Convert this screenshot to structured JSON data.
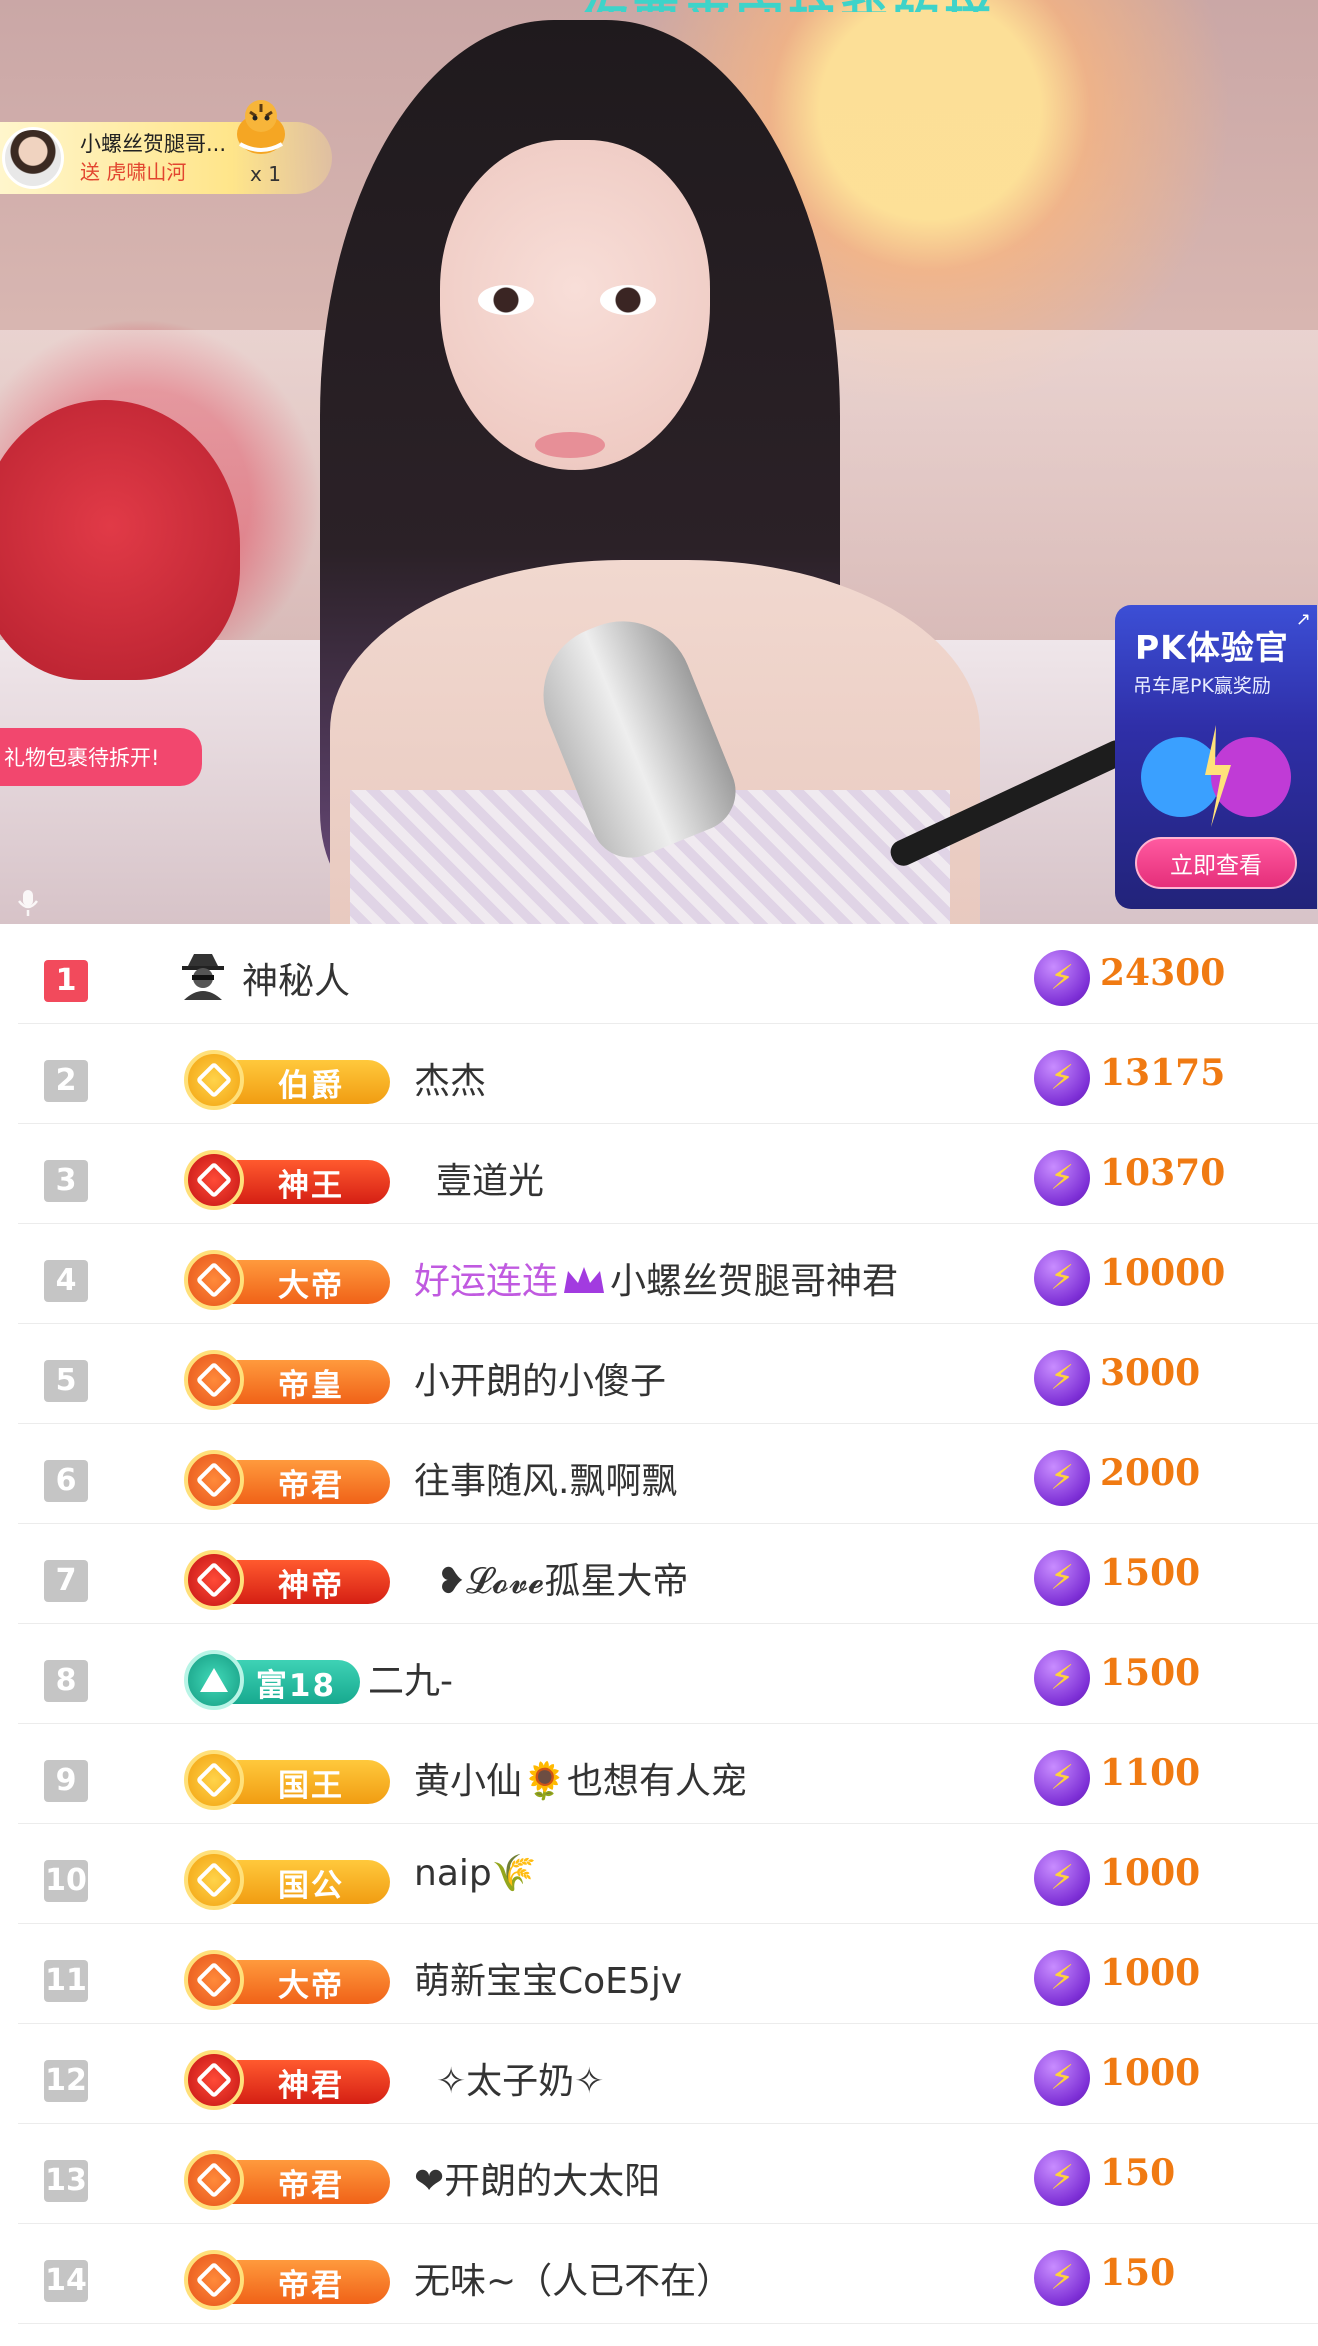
{
  "stream": {
    "top_caption": "你要来守护我的样",
    "gift_toast": {
      "sender": "小螺丝贺腿哥...",
      "action": "送 虎啸山河",
      "count": "x 1"
    },
    "pack_badge": "礼物包裹待拆开!",
    "pk_panel": {
      "title": "PK体验官",
      "subtitle": "吊车尾PK赢奖励",
      "button": "立即查看",
      "close": "↗"
    }
  },
  "leaderboard": [
    {
      "rank": "1",
      "badge": "",
      "badge_style": "none",
      "name": "神秘人",
      "name_prefix": "",
      "score": "24300"
    },
    {
      "rank": "2",
      "badge": "伯爵",
      "badge_style": "gold",
      "name": "杰杰",
      "name_prefix": "",
      "score": "13175"
    },
    {
      "rank": "3",
      "badge": "神王",
      "badge_style": "red",
      "name": "壹道光",
      "name_prefix": "",
      "score": "10370"
    },
    {
      "rank": "4",
      "badge": "大帝",
      "badge_style": "orange",
      "name": "小螺丝贺腿哥神君",
      "name_prefix": "好运连连",
      "score": "10000"
    },
    {
      "rank": "5",
      "badge": "帝皇",
      "badge_style": "orange",
      "name": "小开朗的小傻子",
      "name_prefix": "",
      "score": "3000"
    },
    {
      "rank": "6",
      "badge": "帝君",
      "badge_style": "orange",
      "name": "往事随风.飘啊飘",
      "name_prefix": "",
      "score": "2000"
    },
    {
      "rank": "7",
      "badge": "神帝",
      "badge_style": "red",
      "name": "❥𝓛𝓸𝓿𝓮孤星大帝",
      "name_prefix": "",
      "score": "1500"
    },
    {
      "rank": "8",
      "badge": "富18",
      "badge_style": "teal",
      "name": "二九-",
      "name_prefix": "",
      "score": "1500"
    },
    {
      "rank": "9",
      "badge": "国王",
      "badge_style": "gold",
      "name": "黄小仙🌻也想有人宠",
      "name_prefix": "",
      "score": "1100"
    },
    {
      "rank": "10",
      "badge": "国公",
      "badge_style": "gold",
      "name": "naip🌾",
      "name_prefix": "",
      "score": "1000"
    },
    {
      "rank": "11",
      "badge": "大帝",
      "badge_style": "orange",
      "name": "萌新宝宝CoE5jv",
      "name_prefix": "",
      "score": "1000"
    },
    {
      "rank": "12",
      "badge": "神君",
      "badge_style": "red",
      "name": "✧太子奶✧",
      "name_prefix": "",
      "score": "1000"
    },
    {
      "rank": "13",
      "badge": "帝君",
      "badge_style": "orange",
      "name": "❤开朗的大太阳",
      "name_prefix": "",
      "score": "150"
    },
    {
      "rank": "14",
      "badge": "帝君",
      "badge_style": "orange",
      "name": "无味~（人已不在）",
      "name_prefix": "",
      "score": "150"
    }
  ],
  "icons": {
    "coin": "lightning-coin-icon",
    "mysterious": "spy-icon",
    "crown": "crown-icon",
    "mic": "microphone-icon",
    "gift": "tiger-gift-icon"
  },
  "colors": {
    "score": "#f07a12",
    "rank_top": "#f24a5c",
    "rank_other": "#c5c5c5",
    "pk_button": "#e52e7a",
    "pack_badge": "#f2476e"
  }
}
